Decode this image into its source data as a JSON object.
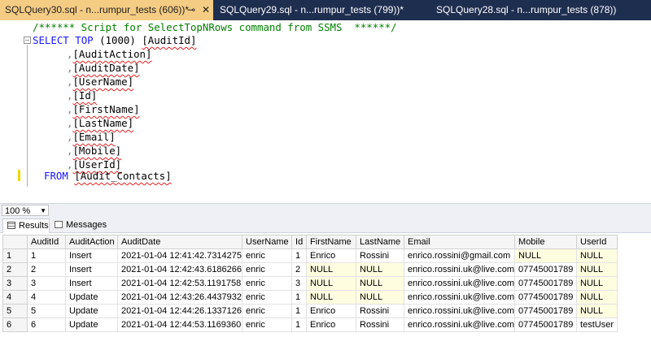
{
  "tabs": [
    {
      "label": "SQLQuery30.sql - n...rumpur_tests (606))*",
      "active": true
    },
    {
      "label": "SQLQuery29.sql - n...rumpur_tests (799))*",
      "active": false
    },
    {
      "label": "SQLQuery28.sql - n...rumpur_tests (878))",
      "active": false
    }
  ],
  "tab_icons": {
    "pin": "pin-icon",
    "close": "close-icon"
  },
  "editor": {
    "comment": "/****** Script for SelectTopNRows command from SSMS  ******/",
    "line2": {
      "k1": "SELECT",
      "k2": "TOP",
      "n": "(1000)",
      "col": "[AuditId]"
    },
    "columns": [
      "[AuditAction]",
      "[AuditDate]",
      "[UserName]",
      "[Id]",
      "[FirstName]",
      "[LastName]",
      "[Email]",
      "[Mobile]",
      "[UserId]"
    ],
    "comma": ",",
    "from_kw": "FROM",
    "from_table": "[Audit_Contacts]"
  },
  "zoom": {
    "value": "100 %"
  },
  "result_tabs": [
    "Results",
    "Messages"
  ],
  "grid": {
    "headers": [
      "AuditId",
      "AuditAction",
      "AuditDate",
      "UserName",
      "Id",
      "FirstName",
      "LastName",
      "Email",
      "Mobile",
      "UserId"
    ],
    "rows": [
      [
        "1",
        "1",
        "Insert",
        "2021-01-04 12:41:42.7314275",
        "enric",
        "1",
        "Enrico",
        "Rossini",
        "enrico.rossini@gmail.com",
        "NULL",
        "NULL"
      ],
      [
        "2",
        "2",
        "Insert",
        "2021-01-04 12:42:43.6186266",
        "enric",
        "2",
        "NULL",
        "NULL",
        "enrico.rossini.uk@live.com",
        "07745001789",
        "NULL"
      ],
      [
        "3",
        "3",
        "Insert",
        "2021-01-04 12:42:53.1191758",
        "enric",
        "3",
        "NULL",
        "NULL",
        "enrico.rossini.uk@live.com",
        "07745001789",
        "NULL"
      ],
      [
        "4",
        "4",
        "Update",
        "2021-01-04 12:43:26.4437932",
        "enric",
        "1",
        "NULL",
        "NULL",
        "enrico.rossini.uk@live.com",
        "07745001789",
        "NULL"
      ],
      [
        "5",
        "5",
        "Update",
        "2021-01-04 12:44:26.1337126",
        "enric",
        "1",
        "Enrico",
        "Rossini",
        "enrico.rossini.uk@live.com",
        "07745001789",
        "NULL"
      ],
      [
        "6",
        "6",
        "Update",
        "2021-01-04 12:44:53.1169360",
        "enric",
        "1",
        "Enrico",
        "Rossini",
        "enrico.rossini.uk@live.com",
        "07745001789",
        "testUser"
      ]
    ]
  },
  "colors": {
    "tabbar": "#1e2e4f",
    "active_tab": "#f5cc84",
    "keyword": "#1515ff",
    "comment": "#008000",
    "null_cell": "#fffde0"
  }
}
